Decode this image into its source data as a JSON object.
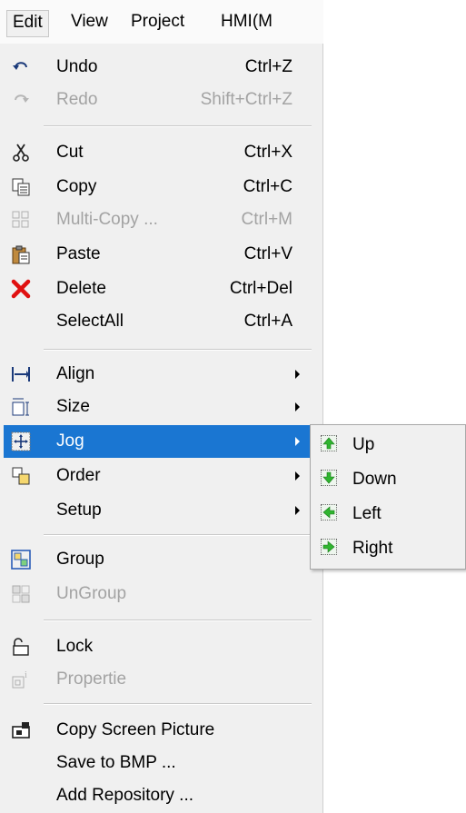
{
  "menubar": {
    "items": [
      {
        "label": "Edit"
      },
      {
        "label": "View"
      },
      {
        "label": "Project"
      },
      {
        "label": "HMI(M"
      }
    ]
  },
  "menu": {
    "undo": {
      "label": "Undo",
      "shortcut": "Ctrl+Z",
      "icon": "undo-icon"
    },
    "redo": {
      "label": "Redo",
      "shortcut": "Shift+Ctrl+Z",
      "icon": "redo-icon"
    },
    "cut": {
      "label": "Cut",
      "shortcut": "Ctrl+X",
      "icon": "scissors-icon"
    },
    "copy": {
      "label": "Copy",
      "shortcut": "Ctrl+C",
      "icon": "copy-icon"
    },
    "multi_copy": {
      "label": "Multi-Copy ...",
      "shortcut": "Ctrl+M",
      "icon": "multi-copy-icon"
    },
    "paste": {
      "label": "Paste",
      "shortcut": "Ctrl+V",
      "icon": "clipboard-icon"
    },
    "delete": {
      "label": "Delete",
      "shortcut": "Ctrl+Del",
      "icon": "red-x-icon"
    },
    "select_all": {
      "label": "SelectAll",
      "shortcut": "Ctrl+A"
    },
    "align": {
      "label": "Align",
      "icon": "align-icon"
    },
    "size": {
      "label": "Size",
      "icon": "size-icon"
    },
    "jog": {
      "label": "Jog",
      "icon": "jog-move-icon"
    },
    "order": {
      "label": "Order",
      "icon": "order-icon"
    },
    "setup": {
      "label": "Setup"
    },
    "group": {
      "label": "Group",
      "icon": "group-icon"
    },
    "ungroup": {
      "label": "UnGroup",
      "icon": "ungroup-icon"
    },
    "lock": {
      "label": "Lock",
      "icon": "lock-icon"
    },
    "propertie": {
      "label": "Propertie",
      "icon": "properties-icon"
    },
    "copy_screen_picture": {
      "label": "Copy Screen Picture",
      "icon": "camera-icon"
    },
    "save_to_bmp": {
      "label": "Save to BMP ..."
    },
    "add_repository": {
      "label": "Add Repository ..."
    }
  },
  "jog_submenu": {
    "items": [
      {
        "label": "Up",
        "icon": "green-arrow-up-icon"
      },
      {
        "label": "Down",
        "icon": "green-arrow-down-icon"
      },
      {
        "label": "Left",
        "icon": "green-arrow-left-icon"
      },
      {
        "label": "Right",
        "icon": "green-arrow-right-icon"
      }
    ]
  },
  "colors": {
    "highlight": "#1a76d2",
    "menu_bg": "#f0f0f0",
    "disabled_text": "#a3a3a3",
    "arrow_green": "#2fb52f"
  }
}
